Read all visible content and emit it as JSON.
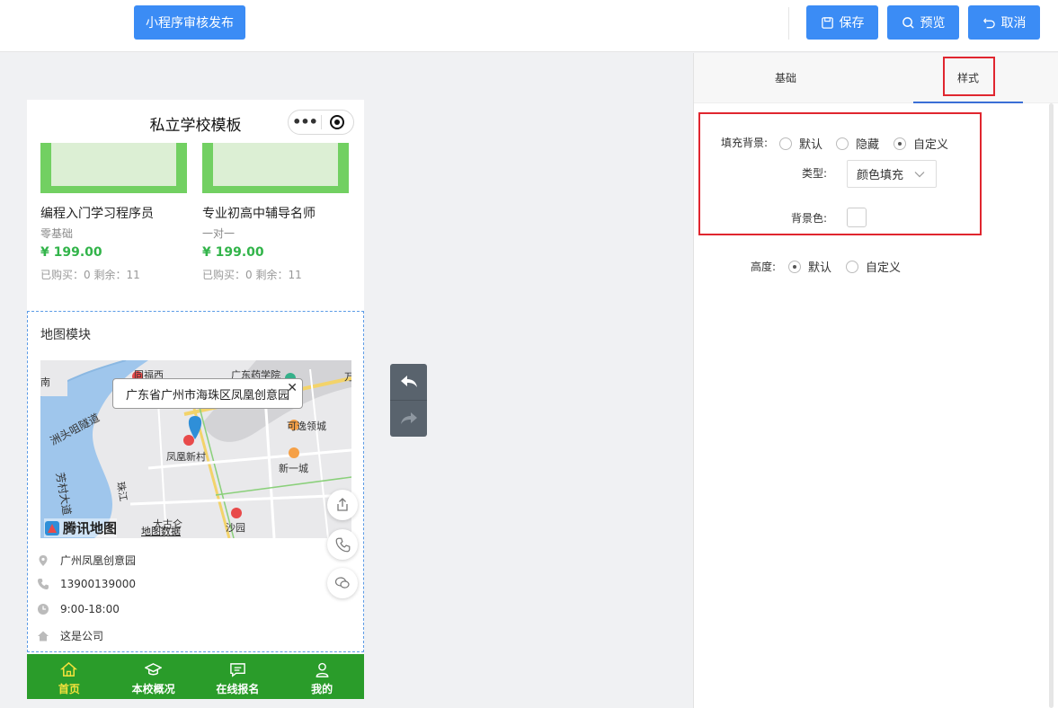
{
  "toolbar": {
    "publish_label": "小程序审核发布",
    "save_label": "保存",
    "preview_label": "预览",
    "cancel_label": "取消",
    "accent_color": "#3b8cf5"
  },
  "phone": {
    "title": "私立学校模板",
    "courses": [
      {
        "name": "编程入门学习程序员",
        "sub": "零基础",
        "price": "¥ 199.00",
        "stats": "已购买：0 剩余：11"
      },
      {
        "name": "专业初高中辅导名师",
        "sub": "一对一",
        "price": "¥ 199.00",
        "stats": "已购买：0 剩余：11"
      }
    ],
    "map_module": {
      "title": "地图模块",
      "bubble": "广东省广州市海珠区凤凰创意园",
      "map_labels": [
        "凤凰新村",
        "可逸领城",
        "新一城",
        "沙园",
        "广东药学院",
        "洲头咀隧道",
        "珠江",
        "芳村大道",
        "大古仑",
        "南",
        "同福西",
        "万"
      ],
      "logo_text": "腾讯地图",
      "credit": "地图数据",
      "info": [
        {
          "icon": "location-icon",
          "text": "广州凤凰创意园"
        },
        {
          "icon": "phone-icon",
          "text": "13900139000"
        },
        {
          "icon": "clock-icon",
          "text": "9:00-18:00"
        },
        {
          "icon": "home-icon",
          "text": "这是公司"
        }
      ]
    },
    "tabbar": {
      "color": "#2a9c2a",
      "active_color": "#f5e23c",
      "items": [
        {
          "label": "首页",
          "icon": "home-icon",
          "active": true
        },
        {
          "label": "本校概况",
          "icon": "graduation-cap-icon",
          "active": false
        },
        {
          "label": "在线报名",
          "icon": "message-icon",
          "active": false
        },
        {
          "label": "我的",
          "icon": "user-icon",
          "active": false
        }
      ]
    }
  },
  "settings": {
    "tabs": [
      {
        "label": "基础",
        "active": false
      },
      {
        "label": "样式",
        "active": true
      }
    ],
    "fill_background": {
      "label": "填充背景:",
      "options": [
        "默认",
        "隐藏",
        "自定义"
      ],
      "selected": "自定义"
    },
    "type": {
      "label": "类型:",
      "value": "颜色填充"
    },
    "bg_color": {
      "label": "背景色:",
      "value": "#ffffff"
    },
    "height": {
      "label": "高度:",
      "options": [
        "默认",
        "自定义"
      ],
      "selected": "默认"
    },
    "highlight_color": "#e0262f"
  }
}
